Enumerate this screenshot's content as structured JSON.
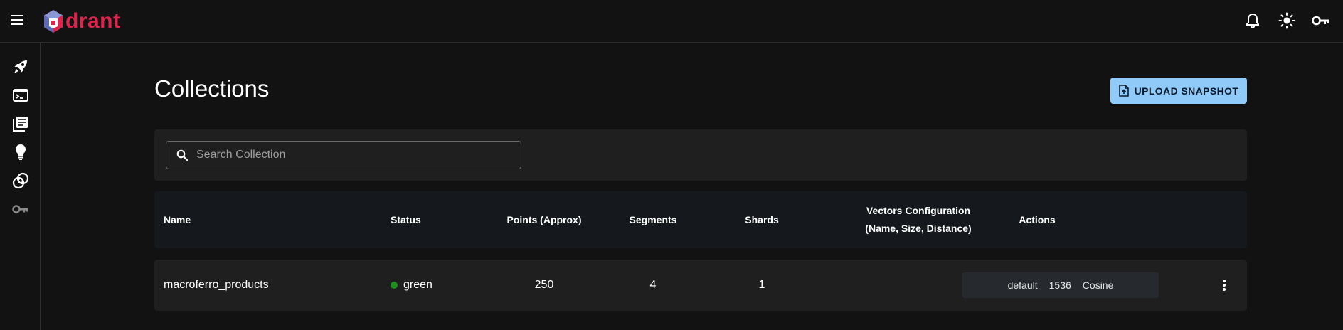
{
  "header": {
    "logo_text": "drant",
    "brand_color": "#dc244c",
    "icons": [
      "menu-icon",
      "bell-icon",
      "sun-icon",
      "key-icon"
    ]
  },
  "sidebar": {
    "items": [
      {
        "icon": "rocket-icon"
      },
      {
        "icon": "console-icon"
      },
      {
        "icon": "collections-icon"
      },
      {
        "icon": "lightbulb-icon"
      },
      {
        "icon": "datasets-icon"
      },
      {
        "icon": "key-icon"
      }
    ]
  },
  "page": {
    "title": "Collections",
    "upload_label": "UPLOAD SNAPSHOT",
    "accent_color": "#90caf9"
  },
  "search": {
    "placeholder": "Search Collection",
    "value": ""
  },
  "table": {
    "headers": {
      "name": "Name",
      "status": "Status",
      "points": "Points (Approx)",
      "segments": "Segments",
      "shards": "Shards",
      "vectors_line1": "Vectors Configuration",
      "vectors_line2": "(Name, Size, Distance)",
      "actions": "Actions"
    },
    "rows": [
      {
        "name": "macroferro_products",
        "status": "green",
        "status_color": "#1e8e1e",
        "points": "250",
        "segments": "4",
        "shards": "1",
        "vector_name": "default",
        "vector_size": "1536",
        "vector_distance": "Cosine"
      }
    ]
  }
}
